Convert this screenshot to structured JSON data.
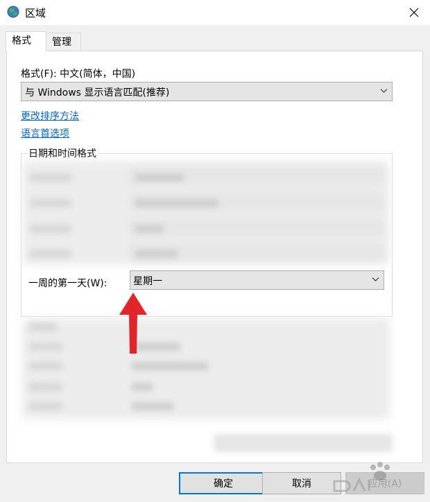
{
  "window": {
    "title": "区域",
    "close_icon": "close-icon",
    "title_icon": "globe-icon"
  },
  "tabs": [
    {
      "label": "格式",
      "active": true
    },
    {
      "label": "管理",
      "active": false
    }
  ],
  "format": {
    "label": "格式(F): 中文(简体，中国)",
    "selected": "与 Windows 显示语言匹配(推荐)"
  },
  "links": {
    "change_sort": "更改排序方法",
    "language_prefs": "语言首选项"
  },
  "datetime_group": {
    "title": "日期和时间格式",
    "first_day_label": "一周的第一天(W):",
    "first_day_value": "星期一"
  },
  "buttons": {
    "ok": "确定",
    "cancel": "取消",
    "apply": "应用(A)"
  },
  "colors": {
    "accent": "#0078d7",
    "link": "#0066cc",
    "arrow": "#e0262b"
  }
}
